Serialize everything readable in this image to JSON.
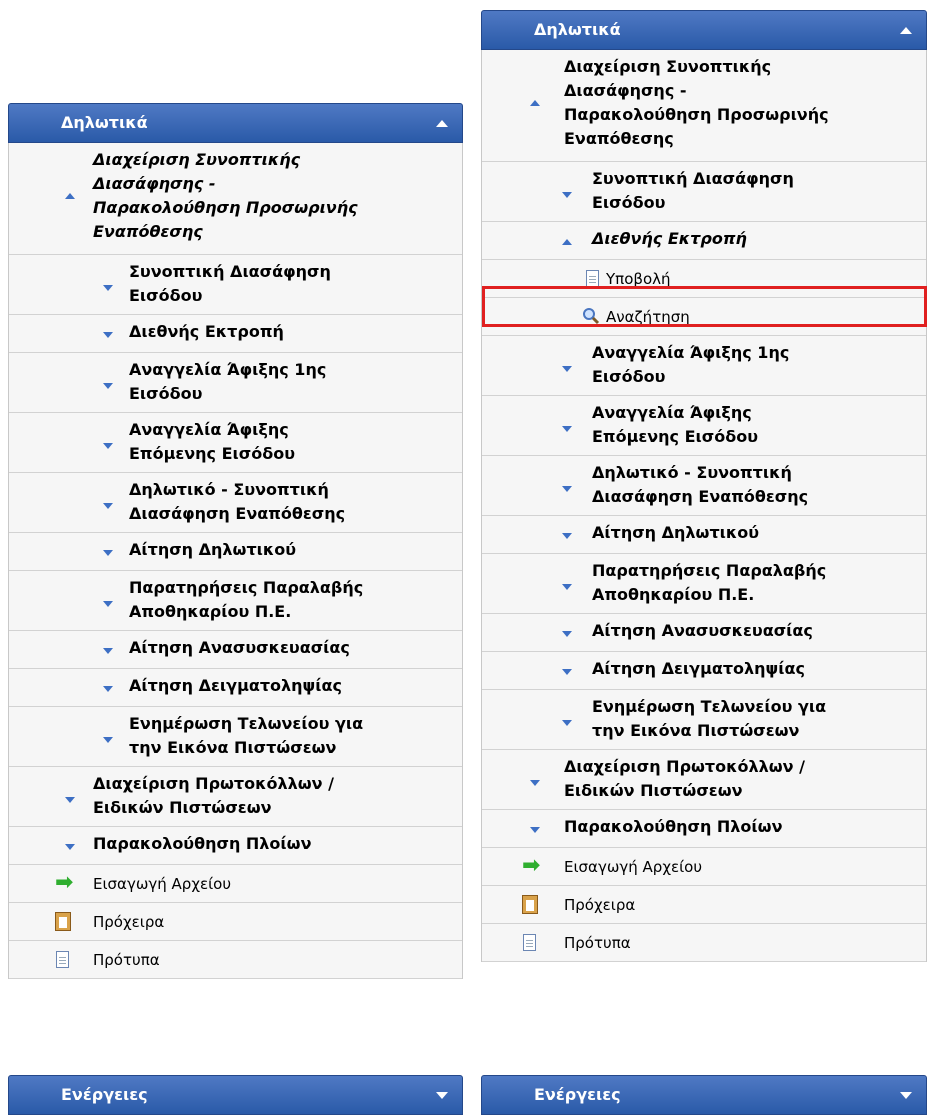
{
  "left_panel": {
    "header": "Δηλωτικά",
    "items": [
      {
        "label_lines": [
          "Διαχείριση Συνοπτικής",
          "Διασάφησης -",
          "Παρακολούθηση Προσωρινής",
          "Εναπόθεσης"
        ],
        "icon": "caret-up-icon"
      },
      {
        "label_lines": [
          "Συνοπτική Διασάφηση",
          "Εισόδου"
        ],
        "icon": "caret-down-icon"
      },
      {
        "label_lines": [
          "Διεθνής Εκτροπή"
        ],
        "icon": "caret-down-icon"
      },
      {
        "label_lines": [
          "Αναγγελία Άφιξης 1ης",
          "Εισόδου"
        ],
        "icon": "caret-down-icon"
      },
      {
        "label_lines": [
          "Αναγγελία Άφιξης",
          "Επόμενης Εισόδου"
        ],
        "icon": "caret-down-icon"
      },
      {
        "label_lines": [
          "Δηλωτικό - Συνοπτική",
          "Διασάφηση Εναπόθεσης"
        ],
        "icon": "caret-down-icon"
      },
      {
        "label_lines": [
          "Αίτηση Δηλωτικού"
        ],
        "icon": "caret-down-icon"
      },
      {
        "label_lines": [
          "Παρατηρήσεις Παραλαβής",
          "Αποθηκαρίου Π.Ε."
        ],
        "icon": "caret-down-icon"
      },
      {
        "label_lines": [
          "Αίτηση Ανασυσκευασίας"
        ],
        "icon": "caret-down-icon"
      },
      {
        "label_lines": [
          "Αίτηση Δειγματοληψίας"
        ],
        "icon": "caret-down-icon"
      },
      {
        "label_lines": [
          "Ενημέρωση Τελωνείου για",
          "την Εικόνα Πιστώσεων"
        ],
        "icon": "caret-down-icon"
      },
      {
        "label_lines": [
          "Διαχείριση Πρωτοκόλλων /",
          "Ειδικών Πιστώσεων"
        ],
        "icon": "caret-down-icon"
      },
      {
        "label_lines": [
          "Παρακολούθηση Πλοίων"
        ],
        "icon": "caret-down-icon"
      },
      {
        "label_lines": [
          "Εισαγωγή Αρχείου"
        ],
        "icon": "green-arrow-icon"
      },
      {
        "label_lines": [
          "Πρόχειρα"
        ],
        "icon": "clipboard-icon"
      },
      {
        "label_lines": [
          "Πρότυπα"
        ],
        "icon": "document-icon"
      }
    ],
    "footer": "Ενέργειες"
  },
  "right_panel": {
    "header": "Δηλωτικά",
    "items": [
      {
        "label_lines": [
          "Διαχείριση Συνοπτικής",
          "Διασάφησης -",
          "Παρακολούθηση Προσωρινής",
          "Εναπόθεσης"
        ],
        "icon": "caret-up-icon"
      },
      {
        "label_lines": [
          "Συνοπτική Διασάφηση",
          "Εισόδου"
        ],
        "icon": "caret-down-icon"
      },
      {
        "label_lines": [
          "Διεθνής Εκτροπή"
        ],
        "icon": "caret-up-icon"
      },
      {
        "label_lines": [
          "Υποβολή"
        ],
        "icon": "document-icon"
      },
      {
        "label_lines": [
          "Αναζήτηση"
        ],
        "icon": "magnifier-icon"
      },
      {
        "label_lines": [
          "Αναγγελία Άφιξης 1ης",
          "Εισόδου"
        ],
        "icon": "caret-down-icon"
      },
      {
        "label_lines": [
          "Αναγγελία Άφιξης",
          "Επόμενης Εισόδου"
        ],
        "icon": "caret-down-icon"
      },
      {
        "label_lines": [
          "Δηλωτικό - Συνοπτική",
          "Διασάφηση Εναπόθεσης"
        ],
        "icon": "caret-down-icon"
      },
      {
        "label_lines": [
          "Αίτηση Δηλωτικού"
        ],
        "icon": "caret-down-icon"
      },
      {
        "label_lines": [
          "Παρατηρήσεις Παραλαβής",
          "Αποθηκαρίου Π.Ε."
        ],
        "icon": "caret-down-icon"
      },
      {
        "label_lines": [
          "Αίτηση Ανασυσκευασίας"
        ],
        "icon": "caret-down-icon"
      },
      {
        "label_lines": [
          "Αίτηση Δειγματοληψίας"
        ],
        "icon": "caret-down-icon"
      },
      {
        "label_lines": [
          "Ενημέρωση Τελωνείου για",
          "την Εικόνα Πιστώσεων"
        ],
        "icon": "caret-down-icon"
      },
      {
        "label_lines": [
          "Διαχείριση Πρωτοκόλλων /",
          "Ειδικών Πιστώσεων"
        ],
        "icon": "caret-down-icon"
      },
      {
        "label_lines": [
          "Παρακολούθηση Πλοίων"
        ],
        "icon": "caret-down-icon"
      },
      {
        "label_lines": [
          "Εισαγωγή Αρχείου"
        ],
        "icon": "green-arrow-icon"
      },
      {
        "label_lines": [
          "Πρόχειρα"
        ],
        "icon": "clipboard-icon"
      },
      {
        "label_lines": [
          "Πρότυπα"
        ],
        "icon": "document-icon"
      }
    ],
    "footer": "Ενέργειες"
  },
  "colors": {
    "header_blue": "#2a5aa8",
    "caret_blue": "#3d6fc4",
    "highlight_red": "#e02020"
  }
}
